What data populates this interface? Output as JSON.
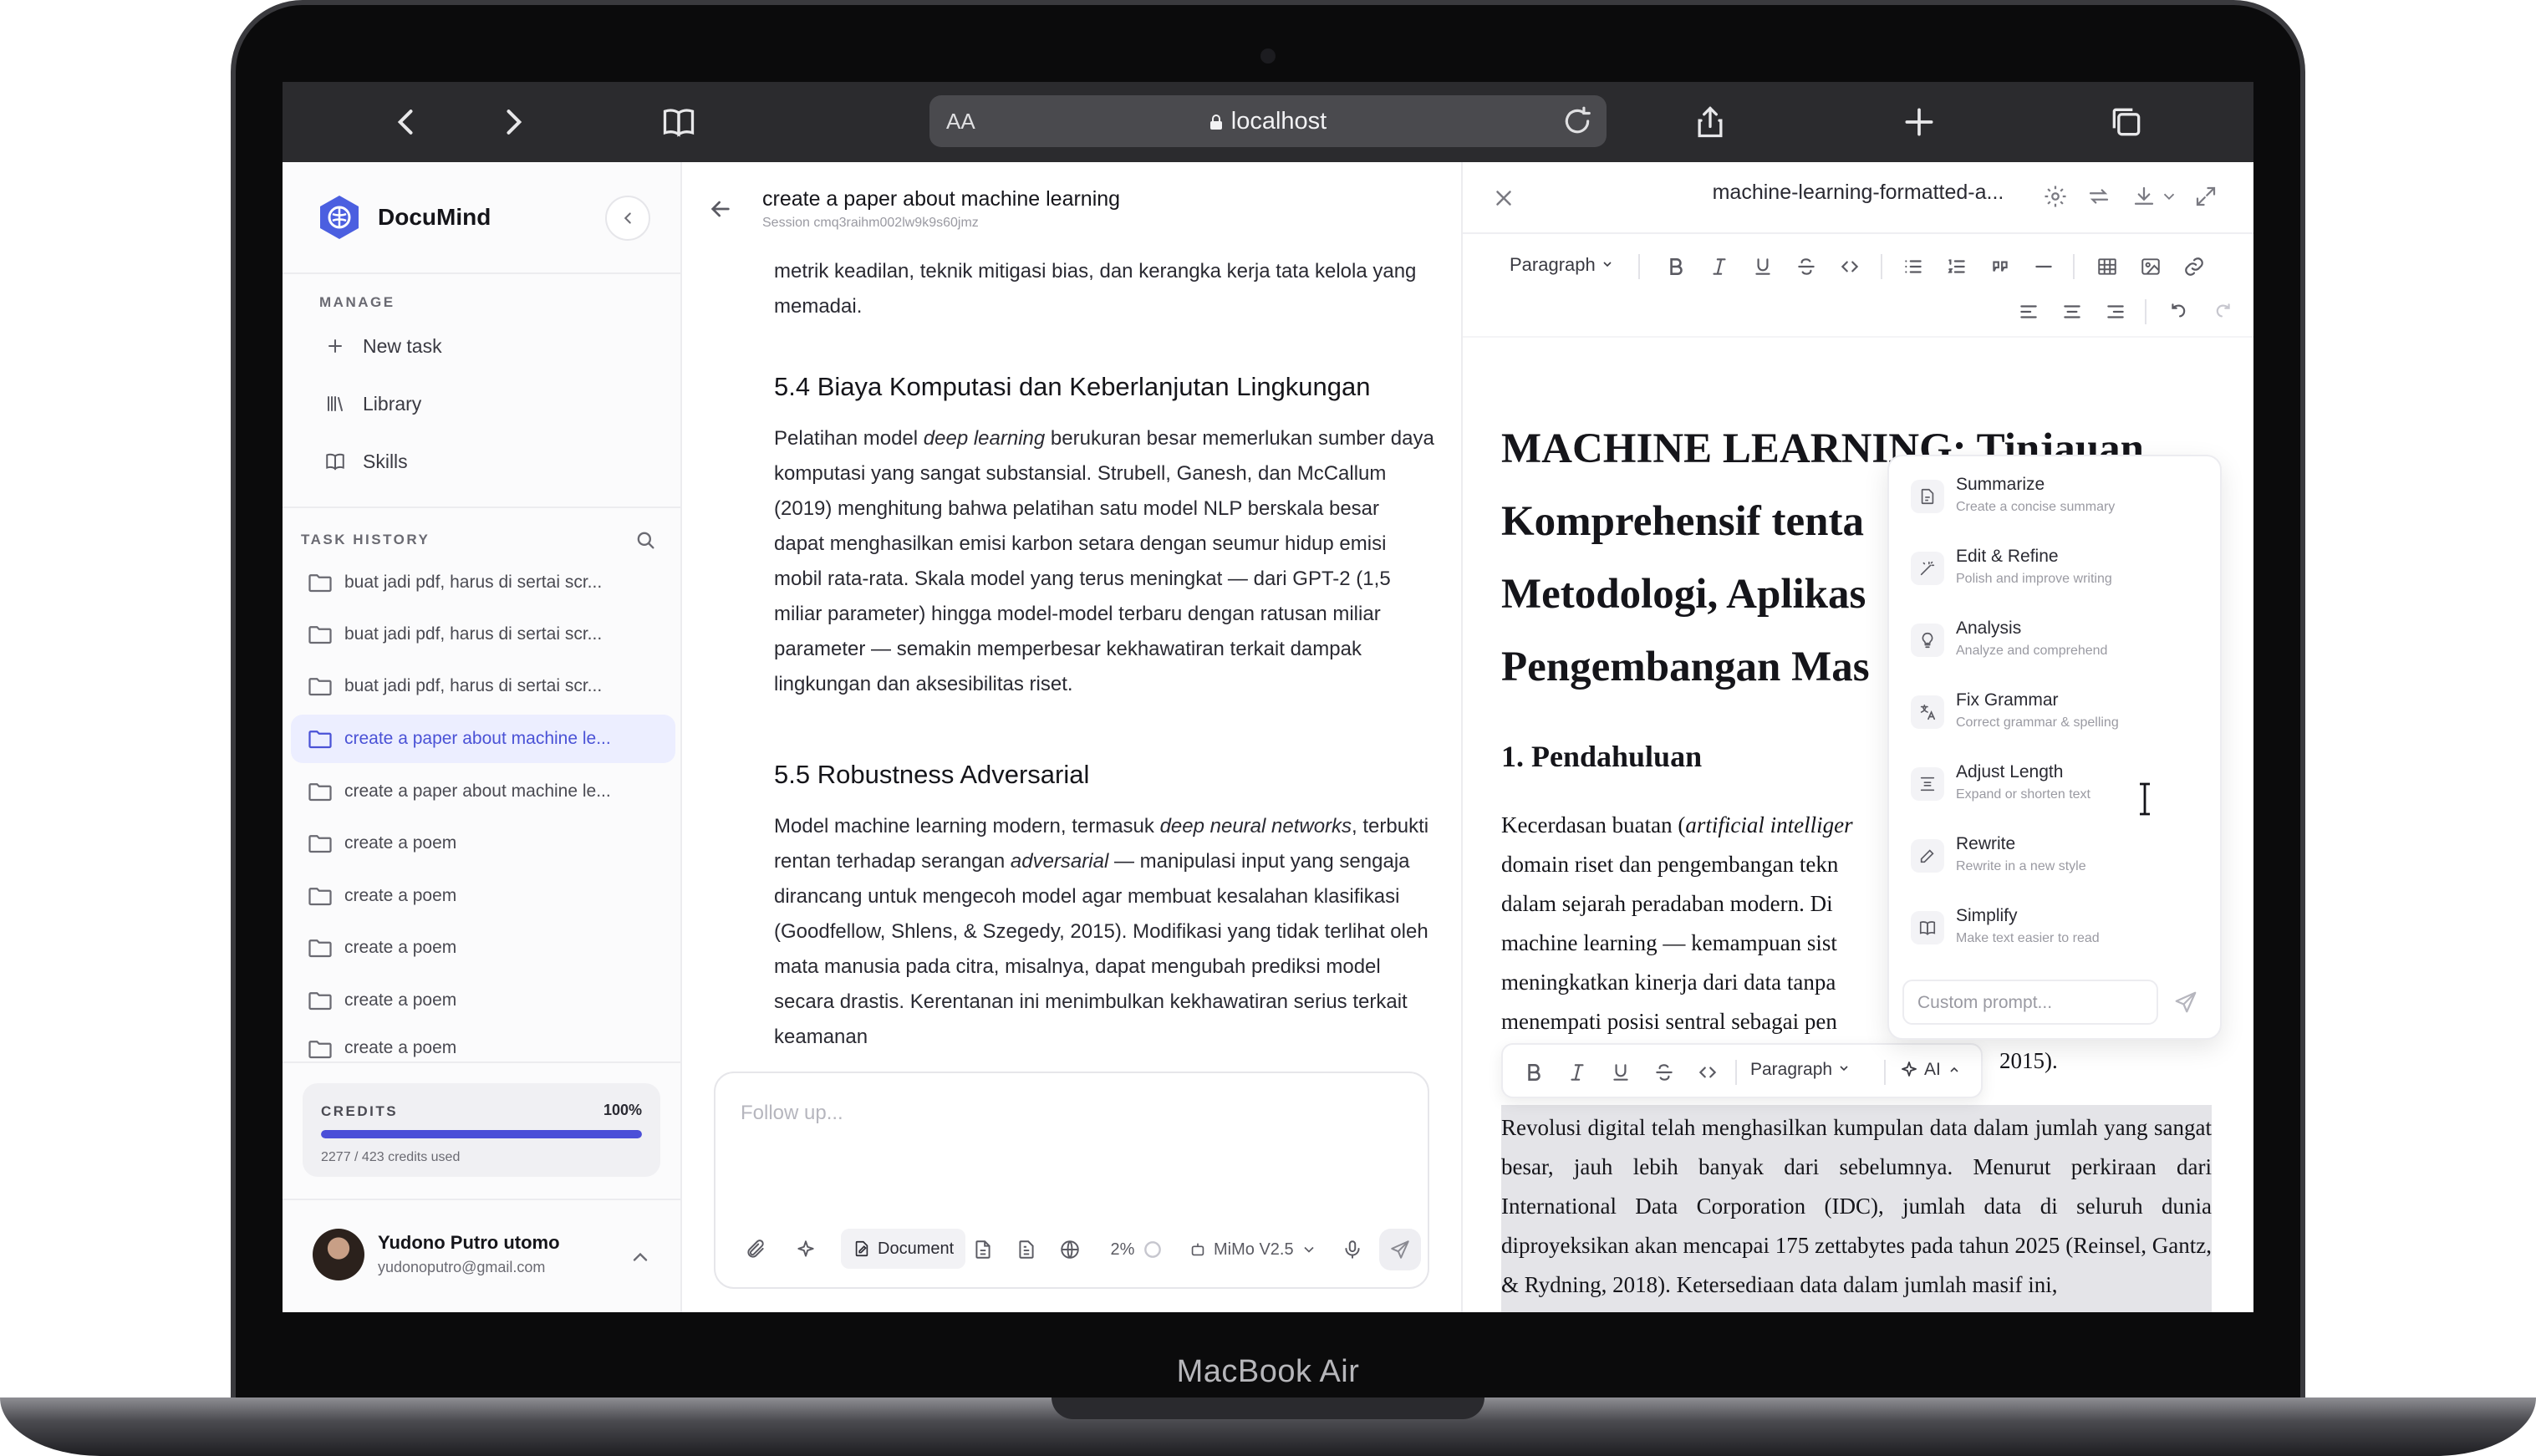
{
  "device": {
    "label": "MacBook Air"
  },
  "browser": {
    "aa_label": "AA",
    "url": "localhost"
  },
  "app": {
    "brand": "DocuMind"
  },
  "sidebar": {
    "manage_label": "MANAGE",
    "nav": [
      {
        "label": "New task",
        "icon": "plus-icon"
      },
      {
        "label": "Library",
        "icon": "library-icon"
      },
      {
        "label": "Skills",
        "icon": "book-icon"
      }
    ],
    "history_label": "TASK HISTORY",
    "history": [
      {
        "label": "buat jadi pdf, harus di sertai scr..."
      },
      {
        "label": "buat jadi pdf, harus di sertai scr..."
      },
      {
        "label": "buat jadi pdf, harus di sertai scr..."
      },
      {
        "label": "create a paper about machine le...",
        "active": true
      },
      {
        "label": "create a paper about machine le..."
      },
      {
        "label": "create a poem"
      },
      {
        "label": "create a poem"
      },
      {
        "label": "create a poem"
      },
      {
        "label": "create a poem"
      },
      {
        "label": "create a poem"
      }
    ],
    "credits": {
      "label": "CREDITS",
      "percent_text": "100%",
      "percent": 100,
      "used_text": "2277 / 423 credits used"
    },
    "user": {
      "name": "Yudono Putro utomo",
      "email": "yudonoputro@gmail.com"
    }
  },
  "chat": {
    "title": "create a paper about machine learning",
    "session": "Session cmq3raihm002lw9k9s60jmz",
    "para_top": "metrik keadilan, teknik mitigasi bias, dan kerangka kerja tata kelola yang memadai.",
    "h_54": "5.4 Biaya Komputasi dan Keberlanjutan Lingkungan",
    "p_54_a": "Pelatihan model ",
    "p_54_em": "deep learning",
    "p_54_b": " berukuran besar memerlukan sumber daya komputasi yang sangat substansial. Strubell, Ganesh, dan McCallum (2019) menghitung bahwa pelatihan satu model NLP berskala besar dapat menghasilkan emisi karbon setara dengan seumur hidup emisi mobil rata-rata. Skala model yang terus meningkat — dari GPT-2 (1,5 miliar parameter) hingga model-model terbaru dengan ratusan miliar parameter — semakin memperbesar kekhawatiran terkait dampak lingkungan dan aksesibilitas riset.",
    "h_55": "5.5 Robustness Adversarial",
    "p_55_a": "Model machine learning modern, termasuk ",
    "p_55_em1": "deep neural networks",
    "p_55_b": ", terbukti rentan terhadap serangan ",
    "p_55_em2": "adversarial",
    "p_55_c": " — manipulasi input yang sengaja dirancang untuk mengecoh model agar membuat kesalahan klasifikasi (Goodfellow, Shlens, & Szegedy, 2015). Modifikasi yang tidak terlihat oleh mata manusia pada citra, misalnya, dapat mengubah prediksi model secara drastis. Kerentanan ini menimbulkan kekhawatiran serius terkait keamanan",
    "composer": {
      "placeholder": "Follow up...",
      "document_label": "Document",
      "percent": "2%",
      "model": "MiMo V2.5"
    }
  },
  "editor": {
    "filename": "machine-learning-formatted-a...",
    "paragraph_label": "Paragraph",
    "h1_lines": [
      "MACHINE LEARNING: Tinjauan",
      "Komprehensif tenta",
      "Metodologi, Aplikas",
      "Pengembangan Mas"
    ],
    "h2": "1. Pendahuluan",
    "intro_lines": [
      "Kecerdasan buatan (",
      "artificial intelliger",
      "domain riset dan pengembangan tekn",
      "dalam sejarah peradaban modern. Di",
      "machine learning — kemampuan sist",
      "meningkatkan kinerja dari data tanpa",
      "menempati posisi sentral sebagai pen",
      "2015)."
    ],
    "selected_text": "Revolusi digital telah menghasilkan kumpulan data dalam jumlah yang sangat besar, jauh lebih banyak dari sebelumnya. Menurut perkiraan dari International Data Corporation (IDC), jumlah data di seluruh dunia diproyeksikan akan mencapai 175 zettabytes pada tahun 2025 (Reinsel, Gantz, & Rydning, 2018). Ketersediaan data dalam jumlah masif ini,",
    "floating_toolbar": {
      "paragraph_label": "Paragraph",
      "ai_label": "AI"
    },
    "ai_menu": [
      {
        "title": "Summarize",
        "desc": "Create a concise summary",
        "icon": "summarize-icon"
      },
      {
        "title": "Edit & Refine",
        "desc": "Polish and improve writing",
        "icon": "wand-icon"
      },
      {
        "title": "Analysis",
        "desc": "Analyze and comprehend",
        "icon": "lightbulb-icon"
      },
      {
        "title": "Fix Grammar",
        "desc": "Correct grammar & spelling",
        "icon": "translate-icon"
      },
      {
        "title": "Adjust Length",
        "desc": "Expand or shorten text",
        "icon": "length-icon"
      },
      {
        "title": "Rewrite",
        "desc": "Rewrite in a new style",
        "icon": "pencil-icon"
      },
      {
        "title": "Simplify",
        "desc": "Make text easier to read",
        "icon": "book-open-icon"
      }
    ],
    "custom_prompt_placeholder": "Custom prompt..."
  }
}
